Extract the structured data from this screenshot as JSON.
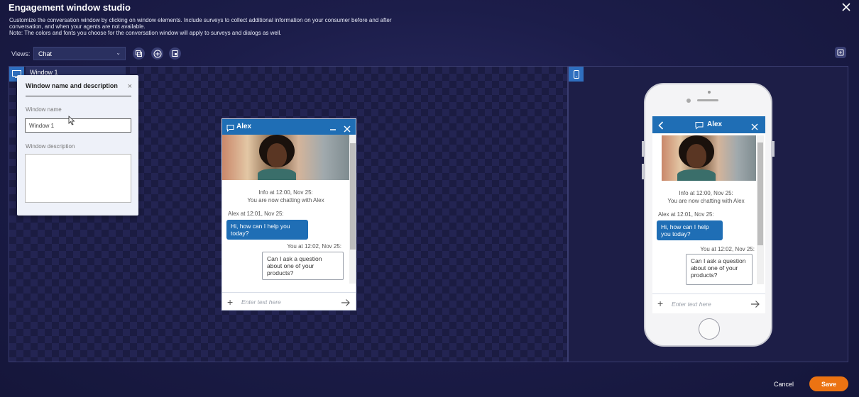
{
  "header": {
    "title": "Engagement window studio",
    "description_lines": [
      "Customize the conversation window by clicking on window elements. Include surveys to collect additional information on your consumer before and after",
      "conversation, and when your agents are not available.",
      "Note: The colors and fonts you choose for the conversation window will apply to surveys and dialogs as well."
    ]
  },
  "toolbar": {
    "views_label": "Views:",
    "views_value": "Chat",
    "icons": [
      "duplicate-icon",
      "add-circle-icon",
      "preview-icon"
    ],
    "right_icon": "expand-icon"
  },
  "canvas": {
    "window_tab_label": "Window 1"
  },
  "popover": {
    "title": "Window name and description",
    "name_label": "Window name",
    "name_value": "Window 1",
    "description_label": "Window description",
    "description_value": ""
  },
  "chat": {
    "agent_name": "Alex",
    "info_line1": "Info at 12:00, Nov 25:",
    "info_line2": "You are now chatting with Alex",
    "agent_meta": "Alex at 12:01, Nov 25:",
    "agent_message": "Hi, how can I help you today?",
    "user_meta": "You at 12:02, Nov 25:",
    "user_message": "Can I ask a question about one of your products?",
    "input_placeholder": "Enter text here"
  },
  "footer": {
    "cancel_label": "Cancel",
    "save_label": "Save"
  },
  "colors": {
    "accent": "#1f6eb5",
    "save": "#ec7312",
    "background": "#1c1d4a"
  }
}
